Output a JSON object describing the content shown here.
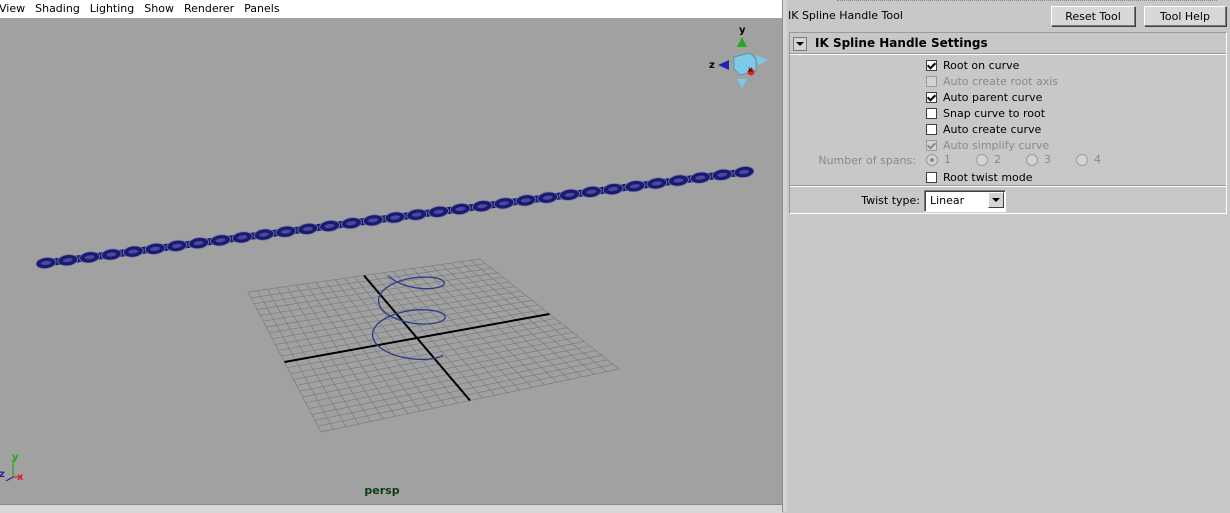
{
  "viewport": {
    "menu": [
      "View",
      "Shading",
      "Lighting",
      "Show",
      "Renderer",
      "Panels"
    ],
    "camera_label": "persp",
    "gizmo_labels": {
      "y": "y",
      "z": "z",
      "x": "x"
    },
    "colors": {
      "background": "#a1a1a1",
      "grid": "#7c7c7c",
      "grid_axis": "#000000",
      "chain": "#1a1a70",
      "curve": "#2b3a8a",
      "camera_label": "#0d3d0d",
      "axis_y": "#22aa22",
      "axis_x": "#dd2222",
      "axis_z": "#2222aa",
      "cube": "#7ecbe8"
    }
  },
  "tool": {
    "title": "IK Spline Handle Tool",
    "reset_label": "Reset Tool",
    "help_label": "Tool Help",
    "section_title": "IK Spline Handle Settings",
    "options": [
      {
        "label": "Root on curve",
        "checked": true,
        "enabled": true
      },
      {
        "label": "Auto create root axis",
        "checked": false,
        "enabled": false
      },
      {
        "label": "Auto parent curve",
        "checked": true,
        "enabled": true
      },
      {
        "label": "Snap curve to root",
        "checked": false,
        "enabled": true
      },
      {
        "label": "Auto create curve",
        "checked": false,
        "enabled": true
      },
      {
        "label": "Auto simplify curve",
        "checked": true,
        "enabled": false
      }
    ],
    "spans": {
      "label": "Number of spans:",
      "options": [
        "1",
        "2",
        "3",
        "4"
      ],
      "selected": "1",
      "enabled": false
    },
    "root_twist": {
      "label": "Root twist mode",
      "checked": false,
      "enabled": true
    },
    "twist": {
      "label": "Twist type:",
      "value": "Linear"
    }
  }
}
